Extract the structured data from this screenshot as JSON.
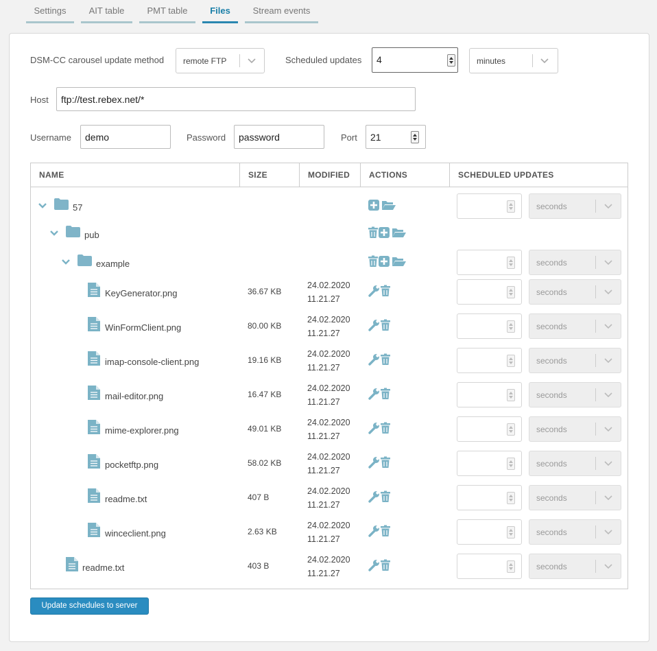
{
  "tabs": [
    {
      "label": "Settings"
    },
    {
      "label": "AIT table"
    },
    {
      "label": "PMT table"
    },
    {
      "label": "Files",
      "active": true
    },
    {
      "label": "Stream events"
    }
  ],
  "form": {
    "method_label": "DSM-CC carousel update method",
    "method_value": "remote FTP",
    "scheduled_label": "Scheduled updates",
    "scheduled_value": "4",
    "scheduled_unit": "minutes",
    "host_label": "Host",
    "host_value": "ftp://test.rebex.net/*",
    "username_label": "Username",
    "username_value": "demo",
    "password_label": "Password",
    "password_value": "password",
    "port_label": "Port",
    "port_value": "21"
  },
  "table": {
    "headers": {
      "name": "NAME",
      "size": "SIZE",
      "modified": "MODIFIED",
      "actions": "ACTIONS",
      "scheduled": "SCHEDULED UPDATES"
    },
    "rows": [
      {
        "type": "folder",
        "level": 0,
        "name": "57",
        "size": "",
        "date": "",
        "time": "",
        "actions": [
          "add",
          "open"
        ],
        "unit": "seconds",
        "has_schedule": true
      },
      {
        "type": "folder",
        "level": 1,
        "name": "pub",
        "size": "",
        "date": "",
        "time": "",
        "actions": [
          "delete",
          "add",
          "open"
        ],
        "unit": "",
        "has_schedule": false
      },
      {
        "type": "folder",
        "level": 2,
        "name": "example",
        "size": "",
        "date": "",
        "time": "",
        "actions": [
          "delete",
          "add",
          "open"
        ],
        "unit": "seconds",
        "has_schedule": true
      },
      {
        "type": "file",
        "level": 3,
        "name": "KeyGenerator.png",
        "size": "36.67 KB",
        "date": "24.02.2020",
        "time": "11.21.27",
        "actions": [
          "edit",
          "delete"
        ],
        "unit": "seconds",
        "has_schedule": true
      },
      {
        "type": "file",
        "level": 3,
        "name": "WinFormClient.png",
        "size": "80.00 KB",
        "date": "24.02.2020",
        "time": "11.21.27",
        "actions": [
          "edit",
          "delete"
        ],
        "unit": "seconds",
        "has_schedule": true
      },
      {
        "type": "file",
        "level": 3,
        "name": "imap-console-client.png",
        "size": "19.16 KB",
        "date": "24.02.2020",
        "time": "11.21.27",
        "actions": [
          "edit",
          "delete"
        ],
        "unit": "seconds",
        "has_schedule": true
      },
      {
        "type": "file",
        "level": 3,
        "name": "mail-editor.png",
        "size": "16.47 KB",
        "date": "24.02.2020",
        "time": "11.21.27",
        "actions": [
          "edit",
          "delete"
        ],
        "unit": "seconds",
        "has_schedule": true
      },
      {
        "type": "file",
        "level": 3,
        "name": "mime-explorer.png",
        "size": "49.01 KB",
        "date": "24.02.2020",
        "time": "11.21.27",
        "actions": [
          "edit",
          "delete"
        ],
        "unit": "seconds",
        "has_schedule": true
      },
      {
        "type": "file",
        "level": 3,
        "name": "pocketftp.png",
        "size": "58.02 KB",
        "date": "24.02.2020",
        "time": "11.21.27",
        "actions": [
          "edit",
          "delete"
        ],
        "unit": "seconds",
        "has_schedule": true
      },
      {
        "type": "file",
        "level": 3,
        "name": "readme.txt",
        "size": "407 B",
        "date": "24.02.2020",
        "time": "11.21.27",
        "actions": [
          "edit",
          "delete"
        ],
        "unit": "seconds",
        "has_schedule": true
      },
      {
        "type": "file",
        "level": 3,
        "name": "winceclient.png",
        "size": "2.63 KB",
        "date": "24.02.2020",
        "time": "11.21.27",
        "actions": [
          "edit",
          "delete"
        ],
        "unit": "seconds",
        "has_schedule": true
      },
      {
        "type": "file",
        "level": 1,
        "name": "readme.txt",
        "size": "403 B",
        "date": "24.02.2020",
        "time": "11.21.27",
        "actions": [
          "edit",
          "delete"
        ],
        "unit": "seconds",
        "has_schedule": true
      }
    ]
  },
  "update_button": "Update schedules to server",
  "colors": {
    "accent": "#2a8cc0",
    "icon": "#7bb3c6",
    "folder_icon": "#7fb4c8"
  }
}
